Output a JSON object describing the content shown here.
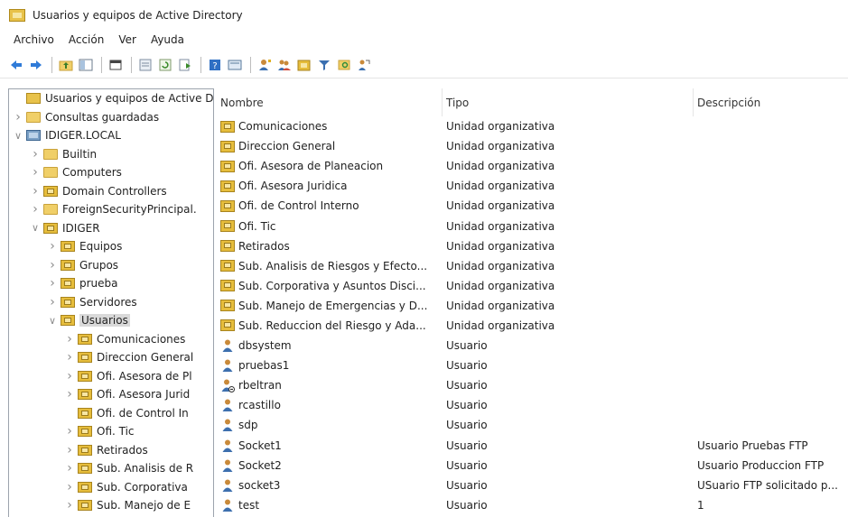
{
  "window": {
    "title": "Usuarios y equipos de Active Directory"
  },
  "menu": [
    "Archivo",
    "Acción",
    "Ver",
    "Ayuda"
  ],
  "toolbar": {
    "buttons": [
      "back-arrow-icon",
      "forward-arrow-icon",
      "sep",
      "up-folder-icon",
      "show-hide-tree-icon",
      "sep",
      "window-icon",
      "sep",
      "properties-icon",
      "refresh-icon",
      "export-icon",
      "sep",
      "help-icon",
      "console-view-icon",
      "sep",
      "new-user-icon",
      "new-group-icon",
      "new-ou-icon",
      "filter-icon",
      "find-icon",
      "delegate-icon"
    ]
  },
  "tree": [
    {
      "label": "Usuarios y equipos de Active Dir",
      "indent": 0,
      "expander": "",
      "icon": "dsroot"
    },
    {
      "label": "Consultas guardadas",
      "indent": 0,
      "expander": ">",
      "icon": "folder"
    },
    {
      "label": "IDIGER.LOCAL",
      "indent": 0,
      "expander": "v",
      "icon": "domain"
    },
    {
      "label": "Builtin",
      "indent": 1,
      "expander": ">",
      "icon": "folder"
    },
    {
      "label": "Computers",
      "indent": 1,
      "expander": ">",
      "icon": "folder"
    },
    {
      "label": "Domain Controllers",
      "indent": 1,
      "expander": ">",
      "icon": "ou"
    },
    {
      "label": "ForeignSecurityPrincipal.",
      "indent": 1,
      "expander": ">",
      "icon": "folder"
    },
    {
      "label": "IDIGER",
      "indent": 1,
      "expander": "v",
      "icon": "ou"
    },
    {
      "label": "Equipos",
      "indent": 2,
      "expander": ">",
      "icon": "ou"
    },
    {
      "label": "Grupos",
      "indent": 2,
      "expander": ">",
      "icon": "ou"
    },
    {
      "label": "prueba",
      "indent": 2,
      "expander": ">",
      "icon": "ou"
    },
    {
      "label": "Servidores",
      "indent": 2,
      "expander": ">",
      "icon": "ou"
    },
    {
      "label": "Usuarios",
      "indent": 2,
      "expander": "v",
      "icon": "ou",
      "selected": true
    },
    {
      "label": "Comunicaciones",
      "indent": 3,
      "expander": ">",
      "icon": "ou"
    },
    {
      "label": "Direccion General",
      "indent": 3,
      "expander": ">",
      "icon": "ou"
    },
    {
      "label": "Ofi. Asesora de Pl",
      "indent": 3,
      "expander": ">",
      "icon": "ou"
    },
    {
      "label": "Ofi. Asesora Jurid",
      "indent": 3,
      "expander": ">",
      "icon": "ou"
    },
    {
      "label": "Ofi. de Control In",
      "indent": 3,
      "expander": "",
      "icon": "ou"
    },
    {
      "label": "Ofi. Tic",
      "indent": 3,
      "expander": ">",
      "icon": "ou"
    },
    {
      "label": "Retirados",
      "indent": 3,
      "expander": ">",
      "icon": "ou"
    },
    {
      "label": "Sub. Analisis de R",
      "indent": 3,
      "expander": ">",
      "icon": "ou"
    },
    {
      "label": "Sub. Corporativa",
      "indent": 3,
      "expander": ">",
      "icon": "ou"
    },
    {
      "label": "Sub. Manejo de E",
      "indent": 3,
      "expander": ">",
      "icon": "ou"
    }
  ],
  "list": {
    "columns": [
      "Nombre",
      "Tipo",
      "Descripción"
    ],
    "rows": [
      {
        "icon": "ou",
        "name": "Comunicaciones",
        "type": "Unidad organizativa",
        "desc": ""
      },
      {
        "icon": "ou",
        "name": "Direccion General",
        "type": "Unidad organizativa",
        "desc": ""
      },
      {
        "icon": "ou",
        "name": "Ofi. Asesora de Planeacion",
        "type": "Unidad organizativa",
        "desc": ""
      },
      {
        "icon": "ou",
        "name": "Ofi. Asesora Juridica",
        "type": "Unidad organizativa",
        "desc": ""
      },
      {
        "icon": "ou",
        "name": "Ofi. de Control Interno",
        "type": "Unidad organizativa",
        "desc": ""
      },
      {
        "icon": "ou",
        "name": "Ofi. Tic",
        "type": "Unidad organizativa",
        "desc": ""
      },
      {
        "icon": "ou",
        "name": "Retirados",
        "type": "Unidad organizativa",
        "desc": ""
      },
      {
        "icon": "ou",
        "name": "Sub. Analisis de Riesgos y Efecto...",
        "type": "Unidad organizativa",
        "desc": ""
      },
      {
        "icon": "ou",
        "name": "Sub. Corporativa y Asuntos Disci...",
        "type": "Unidad organizativa",
        "desc": ""
      },
      {
        "icon": "ou",
        "name": "Sub. Manejo de Emergencias y D...",
        "type": "Unidad organizativa",
        "desc": ""
      },
      {
        "icon": "ou",
        "name": "Sub. Reduccion del Riesgo y Ada...",
        "type": "Unidad organizativa",
        "desc": ""
      },
      {
        "icon": "user",
        "name": "dbsystem",
        "type": "Usuario",
        "desc": ""
      },
      {
        "icon": "user",
        "name": "pruebas1",
        "type": "Usuario",
        "desc": ""
      },
      {
        "icon": "user-disabled",
        "name": "rbeltran",
        "type": "Usuario",
        "desc": ""
      },
      {
        "icon": "user",
        "name": "rcastillo",
        "type": "Usuario",
        "desc": ""
      },
      {
        "icon": "user",
        "name": "sdp",
        "type": "Usuario",
        "desc": ""
      },
      {
        "icon": "user",
        "name": "Socket1",
        "type": "Usuario",
        "desc": "Usuario Pruebas FTP"
      },
      {
        "icon": "user",
        "name": "Socket2",
        "type": "Usuario",
        "desc": "Usuario Produccion FTP"
      },
      {
        "icon": "user",
        "name": "socket3",
        "type": "Usuario",
        "desc": "USuario FTP solicitado p..."
      },
      {
        "icon": "user",
        "name": "test",
        "type": "Usuario",
        "desc": "1"
      }
    ]
  }
}
